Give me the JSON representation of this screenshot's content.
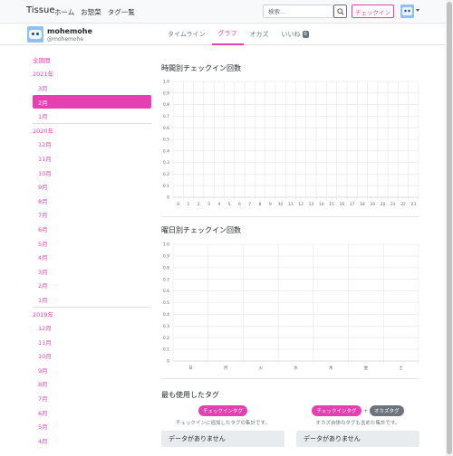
{
  "navbar": {
    "brand": "Tissue",
    "links": [
      "ホーム",
      "お惣菜",
      "タグ一覧"
    ],
    "search_placeholder": "検索...",
    "checkin_label": "チェックイン"
  },
  "profile": {
    "display_name": "mohemohe",
    "user_id": "@mohemohe",
    "tabs": [
      {
        "label": "タイムライン",
        "active": false
      },
      {
        "label": "グラフ",
        "active": true
      },
      {
        "label": "オカズ",
        "active": false
      },
      {
        "label": "いいね",
        "active": false,
        "badge": "0"
      }
    ]
  },
  "sidebar": {
    "all_label": "全期間",
    "groups": [
      {
        "year": "2021年",
        "months": [
          "3月",
          "2月",
          "1月"
        ],
        "active_month": "2月"
      },
      {
        "year": "2020年",
        "months": [
          "12月",
          "11月",
          "10月",
          "9月",
          "8月",
          "7月",
          "6月",
          "5月",
          "4月",
          "3月",
          "2月",
          "1月"
        ]
      },
      {
        "year": "2019年",
        "months": [
          "12月",
          "11月",
          "10月",
          "9月",
          "8月",
          "7月",
          "6月",
          "5月",
          "4月"
        ]
      }
    ]
  },
  "hourly": {
    "title": "時間別チェックイン回数",
    "chart_data": {
      "type": "bar",
      "categories": [
        "0",
        "1",
        "2",
        "3",
        "4",
        "5",
        "6",
        "7",
        "8",
        "9",
        "10",
        "11",
        "12",
        "13",
        "14",
        "15",
        "16",
        "17",
        "18",
        "19",
        "20",
        "21",
        "22",
        "23"
      ],
      "values": [],
      "yticks": [
        "1.0",
        "0.9",
        "0.8",
        "0.7",
        "0.6",
        "0.5",
        "0.4",
        "0.3",
        "0.2",
        "0.1",
        "0"
      ],
      "ylim": [
        0,
        1
      ],
      "grid": true
    }
  },
  "weekday": {
    "title": "曜日別チェックイン回数",
    "chart_data": {
      "type": "bar",
      "categories": [
        "日",
        "月",
        "火",
        "水",
        "木",
        "金",
        "土"
      ],
      "values": [],
      "yticks": [
        "1.0",
        "0.9",
        "0.8",
        "0.7",
        "0.6",
        "0.5",
        "0.4",
        "0.3",
        "0.2",
        "0.1",
        "0"
      ],
      "ylim": [
        0,
        1
      ],
      "grid": true
    }
  },
  "tags": {
    "title": "最も使用したタグ",
    "left_pill": "チェックインタグ",
    "left_desc": "チェックインに追加したタグの集計です。",
    "right_pill1": "チェックインタグ",
    "right_plus": "+",
    "right_pill2": "オカズタグ",
    "right_desc": "オカズ自体のタグも含めた集計です。",
    "no_data_left": "データがありません",
    "no_data_right": "データがありません"
  },
  "colors": {
    "accent": "#e53fb1",
    "muted": "#6c757d"
  }
}
